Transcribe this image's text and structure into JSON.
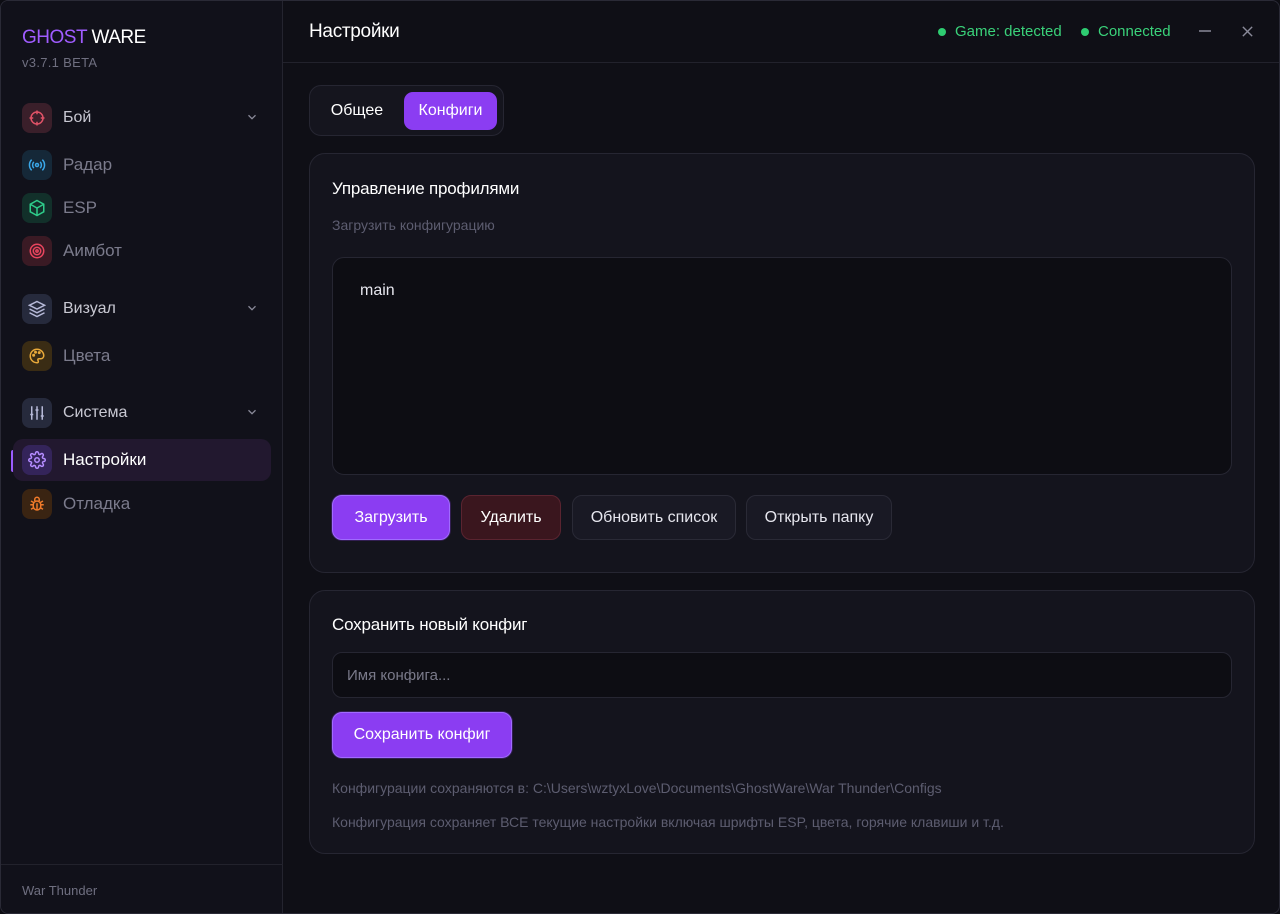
{
  "app": {
    "brand_part1": "GHOST",
    "brand_part2": "WARE",
    "version": "v3.7.1 BETA",
    "footer": "War Thunder"
  },
  "sidebar": {
    "groups": [
      {
        "label": "Бой",
        "icon": "crosshair-icon",
        "color": "#e05267",
        "items": [
          {
            "label": "Радар",
            "icon": "radar-icon",
            "color": "#3aa7e8"
          },
          {
            "label": "ESP",
            "icon": "cube-icon",
            "color": "#2ecc8a"
          },
          {
            "label": "Аимбот",
            "icon": "target-icon",
            "color": "#e8455e"
          }
        ]
      },
      {
        "label": "Визуал",
        "icon": "layers-icon",
        "color": "#a0a4c8",
        "items": [
          {
            "label": "Цвета",
            "icon": "palette-icon",
            "color": "#e8a93a"
          }
        ]
      },
      {
        "label": "Система",
        "icon": "sliders-icon",
        "color": "#a0a4c8",
        "items": [
          {
            "label": "Настройки",
            "icon": "gear-icon",
            "color": "#a87bff",
            "active": true
          },
          {
            "label": "Отладка",
            "icon": "bug-icon",
            "color": "#f07a2a"
          }
        ]
      }
    ]
  },
  "header": {
    "title": "Настройки",
    "status_game": "Game: detected",
    "status_connection": "Connected",
    "minimize": "—",
    "close": "✕"
  },
  "tabs": [
    {
      "label": "Общее",
      "active": false
    },
    {
      "label": "Конфиги",
      "active": true
    }
  ],
  "profiles": {
    "title": "Управление профилями",
    "subtitle": "Загрузить конфигурацию",
    "configs": [
      "main"
    ],
    "buttons": {
      "load": "Загрузить",
      "delete": "Удалить",
      "refresh": "Обновить список",
      "open_folder": "Открыть папку"
    }
  },
  "save": {
    "title": "Сохранить новый конфиг",
    "placeholder": "Имя конфига...",
    "button": "Сохранить конфиг",
    "path_note": "Конфигурации сохраняются в:  C:\\Users\\wztyxLove\\Documents\\GhostWare\\War Thunder\\Configs",
    "info_note": "Конфигурация сохраняет ВСЕ текущие настройки включая шрифты ESP, цвета, горячие клавиши и т.д."
  },
  "colors": {
    "accent": "#8b3df2",
    "status_green": "#2ecc71",
    "danger_bg": "#3a161e"
  }
}
